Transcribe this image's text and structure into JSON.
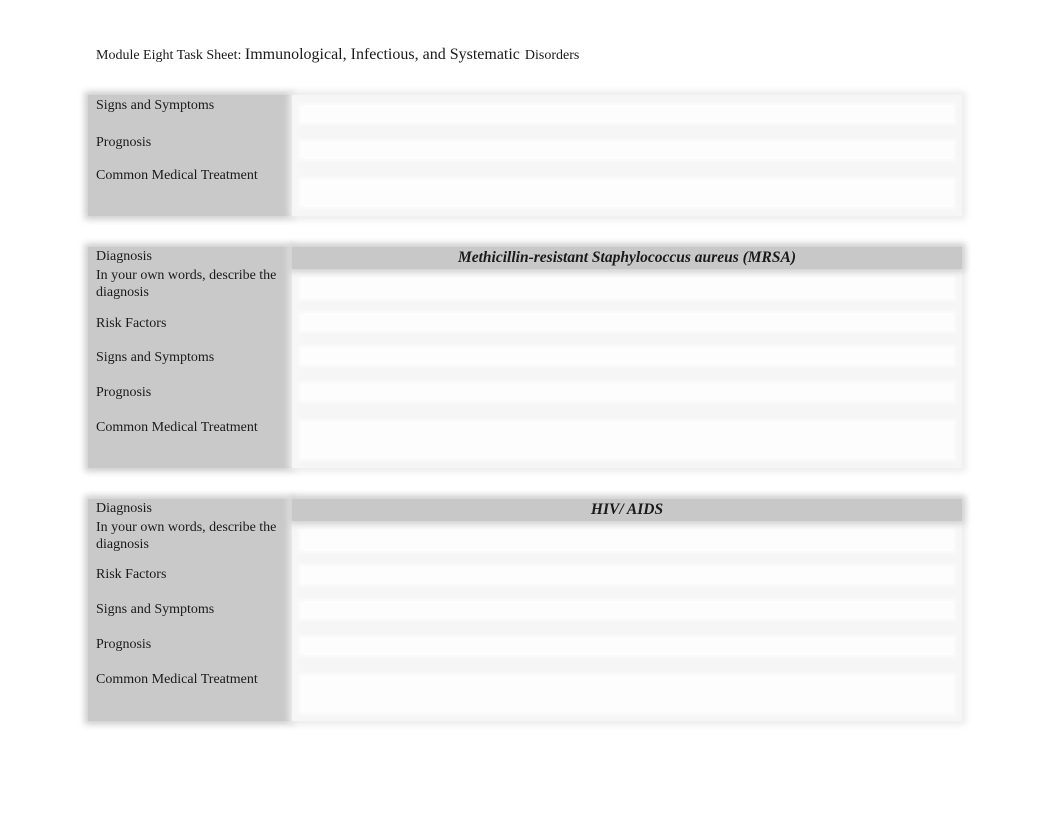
{
  "header": {
    "prefix": "Module Eight Task Sheet: ",
    "main": "Immunological, Infectious, and Systematic",
    "suffix": "Disorders"
  },
  "tables": [
    {
      "title": "",
      "rows": [
        {
          "label": "Signs and Symptoms",
          "answer": ""
        },
        {
          "label": "Prognosis",
          "answer": ""
        },
        {
          "label": "Common Medical Treatment",
          "answer": ""
        }
      ]
    },
    {
      "title": "Methicillin-resistant Staphylococcus aureus (MRSA)",
      "rows": [
        {
          "label": "Diagnosis",
          "answer": ""
        },
        {
          "label": "In your own words, describe the diagnosis",
          "answer": ""
        },
        {
          "label": "Risk Factors",
          "answer": ""
        },
        {
          "label": "Signs and Symptoms",
          "answer": ""
        },
        {
          "label": "Prognosis",
          "answer": ""
        },
        {
          "label": "Common Medical Treatment",
          "answer": ""
        }
      ]
    },
    {
      "title": "HIV/ AIDS",
      "rows": [
        {
          "label": "Diagnosis",
          "answer": ""
        },
        {
          "label": "In your own words, describe the diagnosis",
          "answer": ""
        },
        {
          "label": "Risk Factors",
          "answer": ""
        },
        {
          "label": "Signs and Symptoms",
          "answer": ""
        },
        {
          "label": "Prognosis",
          "answer": ""
        },
        {
          "label": "Common Medical Treatment",
          "answer": ""
        }
      ]
    }
  ]
}
